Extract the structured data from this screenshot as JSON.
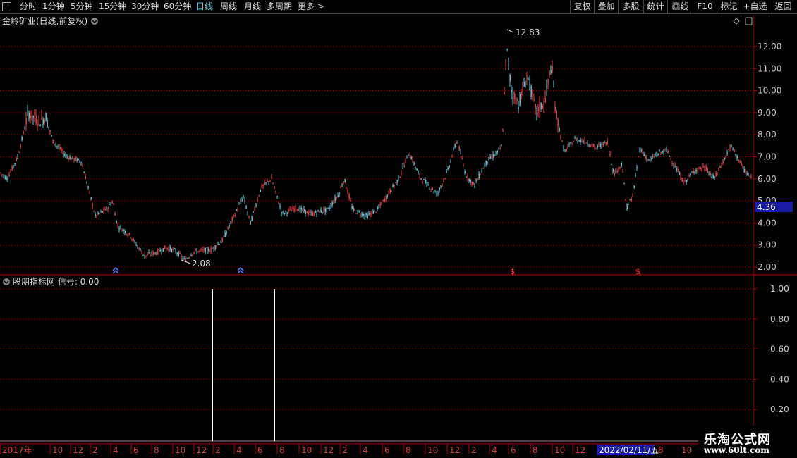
{
  "toolbar": {
    "periods": [
      "分时",
      "1分钟",
      "5分钟",
      "15分钟",
      "30分钟",
      "60分钟",
      "日线",
      "周线",
      "月线",
      "多周期",
      "更多"
    ],
    "active_period": "日线",
    "right": [
      "复权",
      "叠加",
      "多股",
      "统计",
      "画线",
      "F10",
      "标记",
      "+自选",
      "返回"
    ]
  },
  "main_title": "金岭矿业(日线,前复权)",
  "price_axis": [
    "12.00",
    "11.00",
    "10.00",
    "9.00",
    "8.00",
    "7.00",
    "6.00",
    "5.00",
    "4.00",
    "3.00",
    "2.00"
  ],
  "current_price": "4.36",
  "high_label": "12.83",
  "low_label": "2.08",
  "indicator_title": "股朋指标网 信号: 0.00",
  "indicator_axis": [
    "1.00",
    "0.80",
    "0.60",
    "0.40",
    "0.20"
  ],
  "time_axis": [
    "2017年",
    "10",
    "12",
    "2",
    "4",
    "6",
    "8",
    "10",
    "12",
    "2",
    "4",
    "6",
    "8",
    "10",
    "12",
    "2",
    "4",
    "6",
    "8",
    "10",
    "12",
    "2",
    "4",
    "6",
    "8",
    "10",
    "12",
    "2",
    "4",
    "6",
    "8",
    "10",
    "12"
  ],
  "cursor_date": "2022/02/11/五",
  "time_axis_tail": [
    "8",
    "10"
  ],
  "signals": {
    "buy": [
      "1",
      "2"
    ],
    "sell": [
      "3",
      "4"
    ]
  },
  "watermark": {
    "line1": "乐淘公式网",
    "line2": "www.60lt.com"
  },
  "colors": {
    "up": "#ff4040",
    "down": "#5fd1e6",
    "grid": "#8b0000",
    "axis": "#b00000",
    "active": "#5fd1e6",
    "price_box": "#1a1aa8"
  }
}
